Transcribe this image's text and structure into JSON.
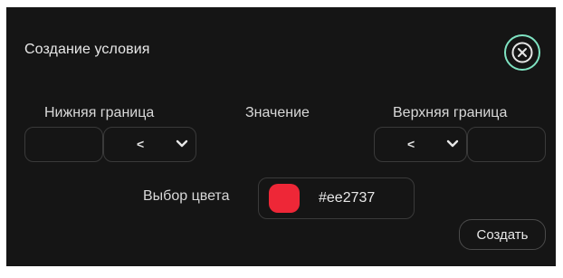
{
  "dialog": {
    "title": "Создание условия"
  },
  "icons": {
    "close": "close-circle-icon",
    "chevron": "chevron-down-icon"
  },
  "labels": {
    "lower_bound": "Нижняя граница",
    "value": "Значение",
    "upper_bound": "Верхняя граница",
    "color_choice": "Выбор цвета"
  },
  "lower": {
    "input_value": "",
    "operator": "<"
  },
  "upper": {
    "input_value": "",
    "operator": "<"
  },
  "color": {
    "hex": "#ee2737",
    "swatch": "#ee2737"
  },
  "accent": "#7fe3c2",
  "buttons": {
    "create": "Создать"
  }
}
